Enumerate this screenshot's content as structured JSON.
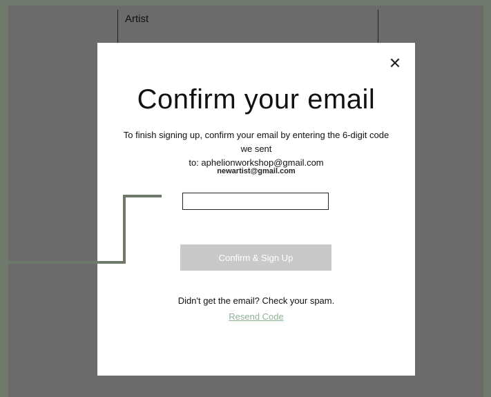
{
  "background": {
    "panel_label": "Artist"
  },
  "modal": {
    "close_icon": "close-icon",
    "title": "Confirm your email",
    "description": "To finish signing up, confirm your email by entering the 6-digit code we sent",
    "sent_to": "to: aphelionworkshop@gmail.com",
    "email_overlay": "newartist@gmail.com",
    "code_input": {
      "value": "",
      "placeholder": ""
    },
    "confirm_button": "Confirm & Sign Up",
    "spam_hint": "Didn't get the email? Check your spam.",
    "resend_link": "Resend Code"
  },
  "colors": {
    "overlay": "#6b6b6b",
    "frame_border": "#6f7a6c",
    "button_disabled": "#c9c9c9",
    "link": "#8fb294"
  }
}
